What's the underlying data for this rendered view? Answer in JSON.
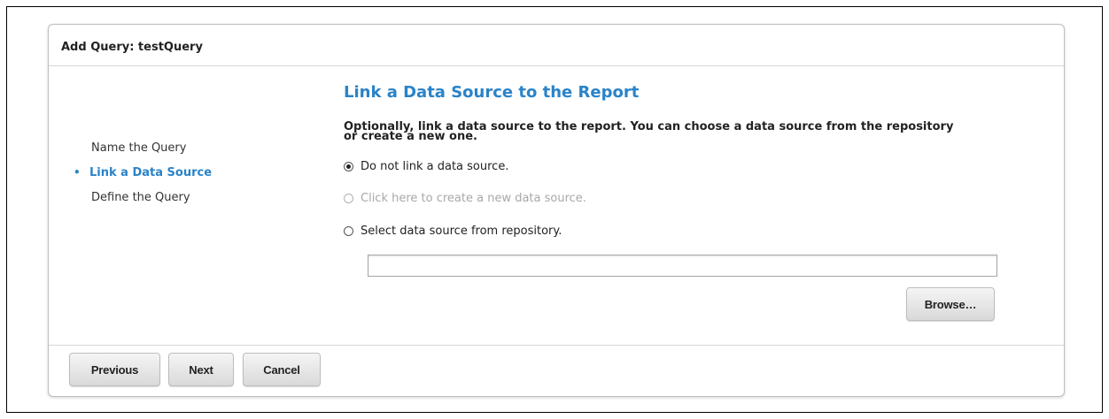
{
  "dialog": {
    "title": "Add Query: testQuery"
  },
  "steps": [
    {
      "label": "Name the Query",
      "active": false
    },
    {
      "label": "Link a Data Source",
      "active": true,
      "bullet": "•"
    },
    {
      "label": "Define the Query",
      "active": false
    }
  ],
  "content": {
    "heading": "Link a Data Source to the Report",
    "description_line1": "Optionally, link a data source to the report. You can choose a data source from the repository",
    "description_line2": "or create a new one.",
    "options": [
      {
        "label": "Do not link a data source.",
        "checked": true,
        "enabled": true
      },
      {
        "label": "Click here to create a new data source.",
        "checked": false,
        "enabled": false
      },
      {
        "label": "Select data source from repository.",
        "checked": false,
        "enabled": true
      }
    ],
    "repository_path_value": "",
    "browse_label": "Browse…"
  },
  "footer": {
    "previous_label": "Previous",
    "next_label": "Next",
    "cancel_label": "Cancel"
  },
  "colors": {
    "accent": "#2a83c8",
    "disabled_text": "#a8a8a8"
  }
}
